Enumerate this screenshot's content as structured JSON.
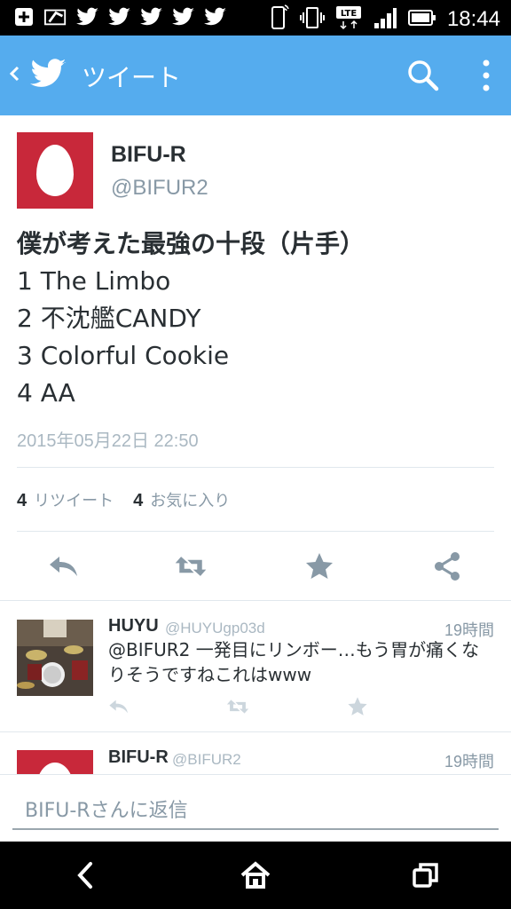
{
  "status_bar": {
    "time": "18:44",
    "network_label": "LTE",
    "icons": [
      "plus-icon",
      "photo-icon",
      "twitter-icon",
      "twitter-icon",
      "twitter-icon",
      "twitter-icon",
      "twitter-icon",
      "phone-icon",
      "vibrate-icon",
      "lte-icon",
      "signal-icon",
      "battery-icon"
    ]
  },
  "app_bar": {
    "title": "ツイート",
    "color": "#55acee",
    "icons": [
      "back-chevron-icon",
      "twitter-bird-icon",
      "search-icon",
      "overflow-menu-icon"
    ]
  },
  "tweet": {
    "author_name": "BIFU-R",
    "author_handle": "@BIFUR2",
    "lines": [
      "僕が考えた最強の十段（片手）",
      "1 The Limbo",
      "2 不沈艦CANDY",
      "3 Colorful Cookie",
      "4 AA"
    ],
    "timestamp": "2015年05月22日 22:50",
    "retweet_count": "4",
    "retweet_label": "リツイート",
    "favorite_count": "4",
    "favorite_label": "お気に入り",
    "actions": [
      "reply-icon",
      "retweet-icon",
      "favorite-star-icon",
      "share-icon"
    ]
  },
  "replies": [
    {
      "name": "HUYU",
      "handle": "@HUYUgp03d",
      "time": "19時間",
      "text": "@BIFUR2 一発目にリンボー…もう胃が痛くなりそうですねこれはwww"
    },
    {
      "name": "BIFU-R",
      "handle": "@BIFUR2",
      "time": "19時間"
    }
  ],
  "composer": {
    "placeholder": "BIFU-Rさんに返信"
  },
  "nav_bar": {
    "icons": [
      "back-icon",
      "home-icon",
      "recents-icon"
    ]
  }
}
